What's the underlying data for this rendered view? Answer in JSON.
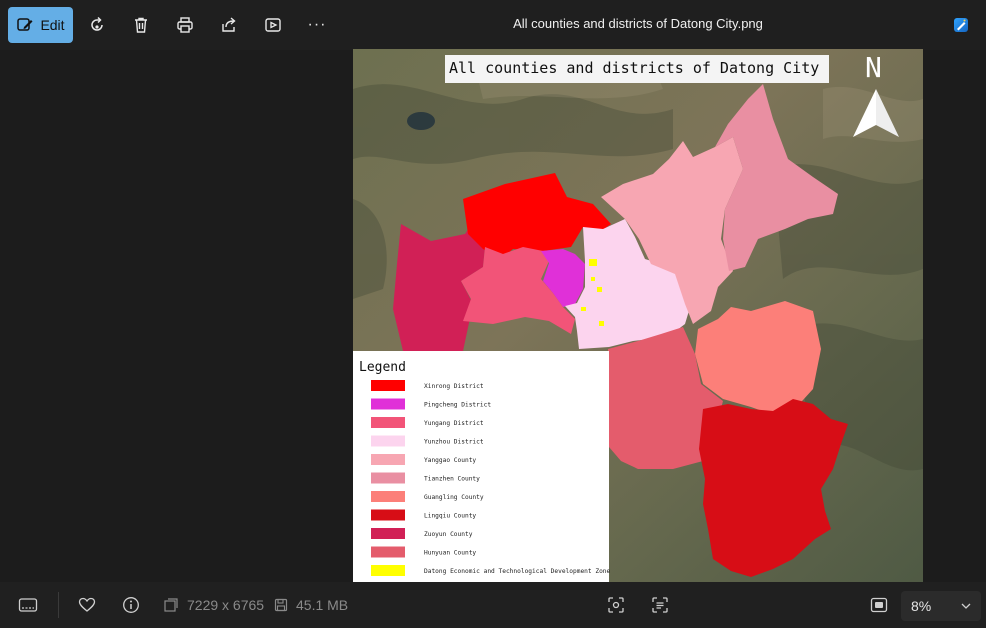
{
  "toolbar": {
    "edit_label": "Edit",
    "more_label": "···",
    "file_title": "All counties and districts of Datong City.png"
  },
  "map": {
    "title": "All counties and districts of Datong City",
    "north_label": "N",
    "legend_title": "Legend",
    "legend": [
      {
        "label": "Xinrong District",
        "color": "#ff0000"
      },
      {
        "label": "Pingcheng District",
        "color": "#e030d8"
      },
      {
        "label": "Yungang District",
        "color": "#f25478"
      },
      {
        "label": "Yunzhou District",
        "color": "#fcd4ee"
      },
      {
        "label": "Yanggao County",
        "color": "#f7a6b2"
      },
      {
        "label": "Tianzhen County",
        "color": "#e98fa2"
      },
      {
        "label": "Guangling County",
        "color": "#fc7f79"
      },
      {
        "label": "Lingqiu County",
        "color": "#d70d16"
      },
      {
        "label": "Zuoyun County",
        "color": "#d12056"
      },
      {
        "label": "Hunyuan County",
        "color": "#e45c6c"
      },
      {
        "label": "Datong Economic and Technological Development Zone",
        "color": "#ffff00"
      }
    ]
  },
  "status": {
    "dimensions": "7229 x 6765",
    "file_size": "45.1 MB",
    "zoom": "8%"
  }
}
